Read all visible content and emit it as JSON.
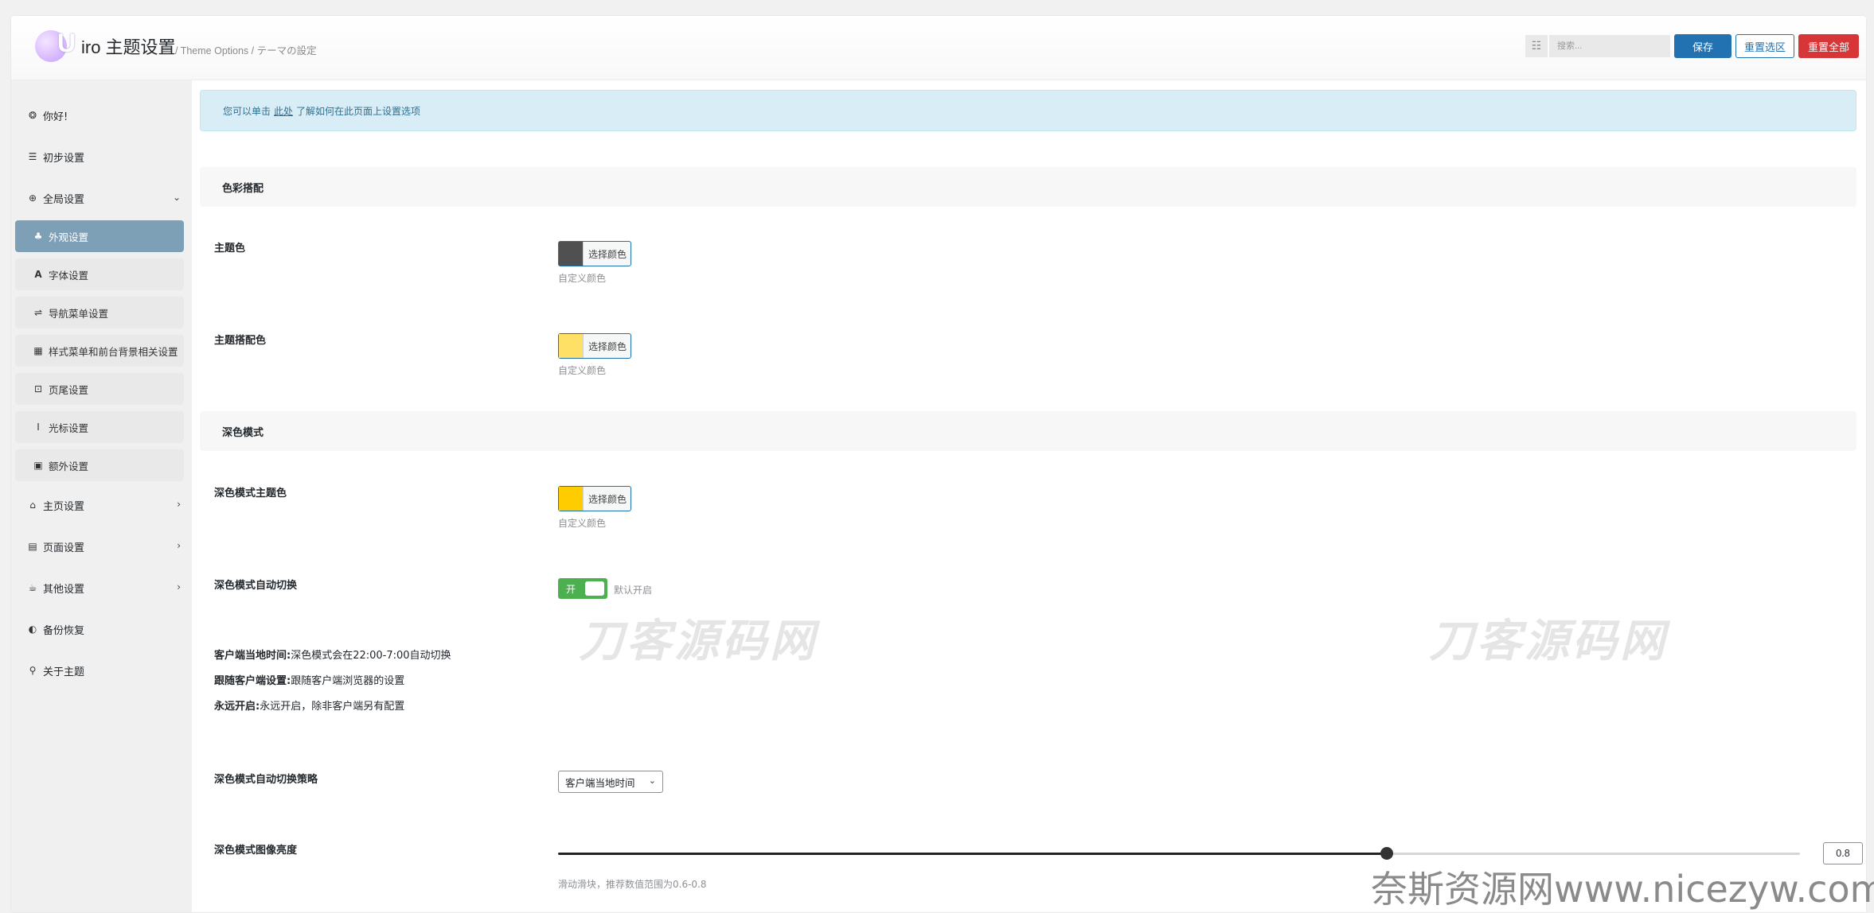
{
  "header": {
    "title": "iro 主题设置",
    "subtitle": "/ Theme Options / テーマの設定",
    "logo_glyph": "U",
    "search_placeholder": "搜索...",
    "save_label": "保存",
    "reset_section_label": "重置选区",
    "reset_all_label": "重置全部"
  },
  "sidebar": {
    "items": [
      {
        "label": "你好!",
        "icon": "balloon-icon"
      },
      {
        "label": "初步设置",
        "icon": "bars-icon"
      },
      {
        "label": "全局设置",
        "icon": "globe-icon"
      },
      {
        "label": "主页设置",
        "icon": "home-icon"
      },
      {
        "label": "页面设置",
        "icon": "file-icon"
      },
      {
        "label": "其他设置",
        "icon": "coffee-icon"
      },
      {
        "label": "备份恢复",
        "icon": "shield-icon"
      },
      {
        "label": "关于主题",
        "icon": "paperclip-icon"
      }
    ],
    "subitems": [
      {
        "label": "外观设置",
        "icon": "tree-icon"
      },
      {
        "label": "字体设置",
        "icon": "font-icon"
      },
      {
        "label": "导航菜单设置",
        "icon": "signpost-icon"
      },
      {
        "label": "样式菜单和前台背景相关设置",
        "icon": "grid-icon"
      },
      {
        "label": "页尾设置",
        "icon": "square-caret-icon"
      },
      {
        "label": "光标设置",
        "icon": "i-cursor-icon"
      },
      {
        "label": "额外设置",
        "icon": "gift-icon"
      }
    ]
  },
  "notice": {
    "before": "您可以单击",
    "link": "此处",
    "after": "了解如何在此页面上设置选项"
  },
  "sections": {
    "color": "色彩搭配",
    "dark": "深色模式"
  },
  "fields": {
    "theme_color": {
      "label": "主题色",
      "button": "选择颜色",
      "desc": "自定义颜色",
      "color": "#505050"
    },
    "theme_accent": {
      "label": "主题搭配色",
      "button": "选择颜色",
      "desc": "自定义颜色",
      "color": "#ffe066"
    },
    "dark_theme_color": {
      "label": "深色模式主题色",
      "button": "选择颜色",
      "desc": "自定义颜色",
      "color": "#ffcc00"
    },
    "dark_auto": {
      "label": "深色模式自动切换",
      "toggle_text": "开",
      "desc": "默认开启",
      "on": true
    },
    "dark_info": [
      {
        "key": "客户端当地时间:",
        "value": "深色模式会在22:00-7:00自动切换"
      },
      {
        "key": "跟随客户端设置:",
        "value": "跟随客户端浏览器的设置"
      },
      {
        "key": "永远开启:",
        "value": "永远开启，除非客户端另有配置"
      }
    ],
    "dark_strategy": {
      "label": "深色模式自动切换策略",
      "selected": "客户端当地时间"
    },
    "dark_brightness": {
      "label": "深色模式图像亮度",
      "value": "0.8",
      "fraction": 0.667,
      "desc": "滑动滑块，推荐数值范围为0.6-0.8"
    }
  },
  "watermarks": {
    "text": "刀客源码网",
    "site": "奈斯资源网www.nicezyw.com"
  }
}
